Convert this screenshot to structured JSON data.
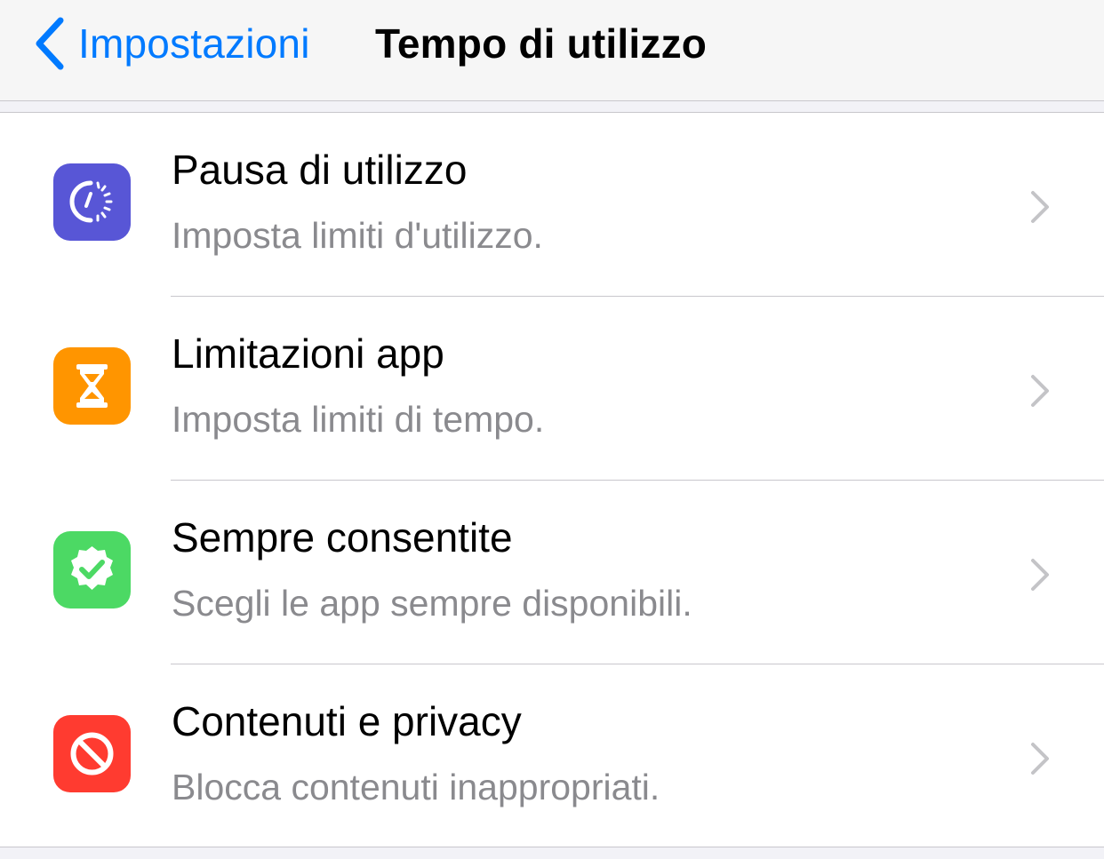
{
  "navbar": {
    "back_label": "Impostazioni",
    "title": "Tempo di utilizzo"
  },
  "colors": {
    "accent": "#007aff",
    "downtime": "#5856d6",
    "app_limits": "#ff9500",
    "always_allowed": "#4cd964",
    "content_privacy": "#ff3b30"
  },
  "items": [
    {
      "title": "Pausa di utilizzo",
      "subtitle": "Imposta limiti d'utilizzo.",
      "icon": "downtime-icon"
    },
    {
      "title": "Limitazioni app",
      "subtitle": "Imposta limiti di tempo.",
      "icon": "hourglass-icon"
    },
    {
      "title": "Sempre consentite",
      "subtitle": "Scegli le app sempre disponibili.",
      "icon": "checkmark-badge-icon"
    },
    {
      "title": "Contenuti e privacy",
      "subtitle": "Blocca contenuti inappropriati.",
      "icon": "no-entry-icon"
    }
  ]
}
